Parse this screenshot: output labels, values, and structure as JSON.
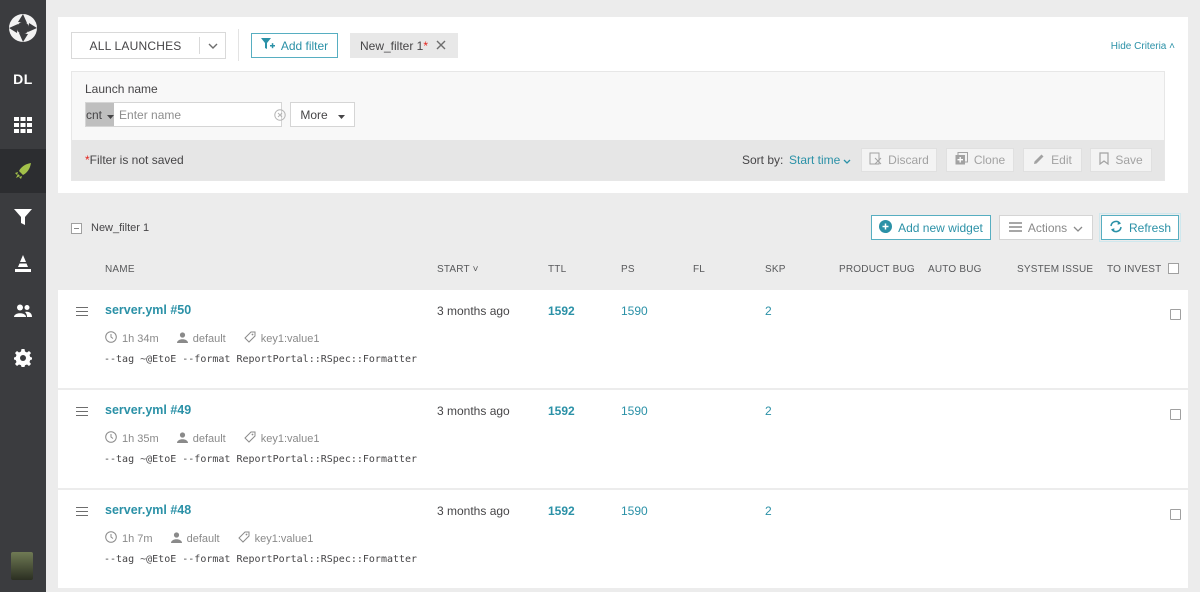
{
  "sidebar": {
    "items": [
      {
        "name": "logo-icon",
        "label": ""
      },
      {
        "name": "project-dl",
        "label": "DL"
      },
      {
        "name": "dashboards-icon",
        "label": ""
      },
      {
        "name": "launches-icon",
        "label": ""
      },
      {
        "name": "filters-icon",
        "label": ""
      },
      {
        "name": "debug-icon",
        "label": ""
      },
      {
        "name": "members-icon",
        "label": ""
      },
      {
        "name": "settings-icon",
        "label": ""
      }
    ],
    "active": "launches-icon"
  },
  "filter_bar": {
    "all_launches_label": "ALL LAUNCHES",
    "add_filter_label": "Add filter",
    "chip_label": "New_filter 1",
    "chip_star": "*",
    "hide_criteria_label": "Hide Criteria"
  },
  "criteria": {
    "field_label": "Launch name",
    "condition": "cnt",
    "name_placeholder": "Enter name",
    "name_value": "",
    "more_label": "More",
    "not_saved_star": "*",
    "not_saved_text": "Filter is not saved",
    "sort_by_label": "Sort by:",
    "sort_value": "Start time",
    "discard_label": "Discard",
    "clone_label": "Clone",
    "edit_label": "Edit",
    "save_label": "Save"
  },
  "launches_header": {
    "filter_name": "New_filter 1",
    "add_widget_label": "Add new widget",
    "actions_label": "Actions",
    "refresh_label": "Refresh"
  },
  "columns": [
    "NAME",
    "START",
    "TTL",
    "PS",
    "FL",
    "SKP",
    "PRODUCT BUG",
    "AUTO BUG",
    "SYSTEM ISSUE",
    "TO INVEST"
  ],
  "rows": [
    {
      "name": "server.yml #50",
      "duration": "1h 34m",
      "owner": "default",
      "tag": "key1:value1",
      "command": "--tag ~@EtoE --format ReportPortal::RSpec::Formatter",
      "start": "3 months ago",
      "ttl": "1592",
      "ps": "1590",
      "skp": "2"
    },
    {
      "name": "server.yml #49",
      "duration": "1h 35m",
      "owner": "default",
      "tag": "key1:value1",
      "command": "--tag ~@EtoE --format ReportPortal::RSpec::Formatter",
      "start": "3 months ago",
      "ttl": "1592",
      "ps": "1590",
      "skp": "2"
    },
    {
      "name": "server.yml #48",
      "duration": "1h 7m",
      "owner": "default",
      "tag": "key1:value1",
      "command": "--tag ~@EtoE --format ReportPortal::RSpec::Formatter",
      "start": "3 months ago",
      "ttl": "1592",
      "ps": "1590",
      "skp": "2"
    }
  ],
  "colors": {
    "accent": "#2b91a7",
    "sidebar": "#3b3c3f",
    "required_star": "#e3251e"
  }
}
